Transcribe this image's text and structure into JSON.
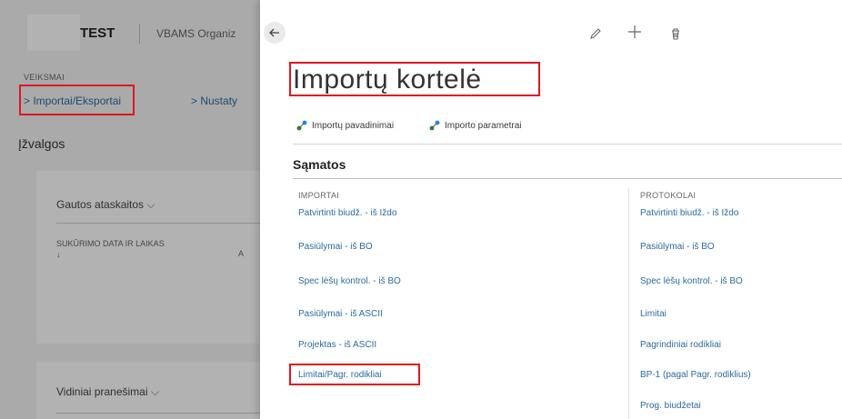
{
  "background": {
    "company": "TEST",
    "org": "VBAMS Organiz",
    "actions_title": "VEIKSMAI",
    "actions": [
      "> Importai/Eksportai",
      "> Nustaty"
    ],
    "insights_title": "Įžvalgos",
    "card1": {
      "title": "Gautos ataskaitos",
      "col_head": "SUKŪRIMO DATA IR LAIKAS ↓",
      "col_a": "A"
    },
    "card2": {
      "title": "Vidiniai pranešimai"
    }
  },
  "panel": {
    "title": "Importų kortelė",
    "toolbar": {
      "edit_icon": "pencil-icon",
      "add_icon": "plus-icon",
      "delete_icon": "trash-icon"
    },
    "actions": [
      "Importų pavadinimai",
      "Importo parametrai"
    ],
    "section_title": "Sąmatos",
    "columns": {
      "left_title": "IMPORTAI",
      "left": [
        "Patvirtinti biudž. - iš Iždo",
        "Pasiūlymai - iš BO",
        "Spec lėšų kontrol. - iš BO",
        "Pasiūlymai - iš ASCII",
        "Projektas - iš ASCII",
        "Limitai/Pagr. rodikliai"
      ],
      "right_title": "PROTOKOLAI",
      "right": [
        "Patvirtinti biudž. - iš Iždo",
        "Pasiūlymai - iš BO",
        "Spec lėšų kontrol. - iš BO",
        "Limitai",
        "Pagrindiniai rodikliai",
        "BP-1 (pagal Pagr. rodiklius)",
        "Prog. biudžetai"
      ]
    }
  },
  "colors": {
    "accent": "#2c6aa0",
    "highlight": "#e0171f"
  }
}
